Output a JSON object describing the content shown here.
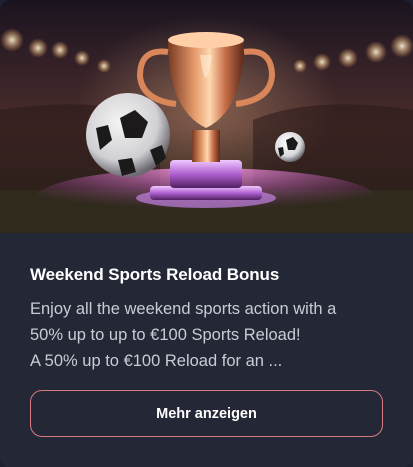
{
  "card": {
    "title": "Weekend Sports Reload Bonus",
    "description_lines": [
      "Enjoy all the weekend sports action with a",
      "50% up to up to €100 Sports Reload!",
      "A 50% up to €100 Reload for an ..."
    ],
    "more_button_label": "Mehr anzeigen",
    "image": {
      "subject": "trophy-with-soccer-balls-stadium",
      "accent_colors": [
        "#e48a5a",
        "#c86ad8",
        "#f3c38a"
      ]
    }
  },
  "colors": {
    "card_background": "#242836",
    "title_text": "#ffffff",
    "body_text": "#c8ccd6",
    "button_border": "#d97a80"
  }
}
